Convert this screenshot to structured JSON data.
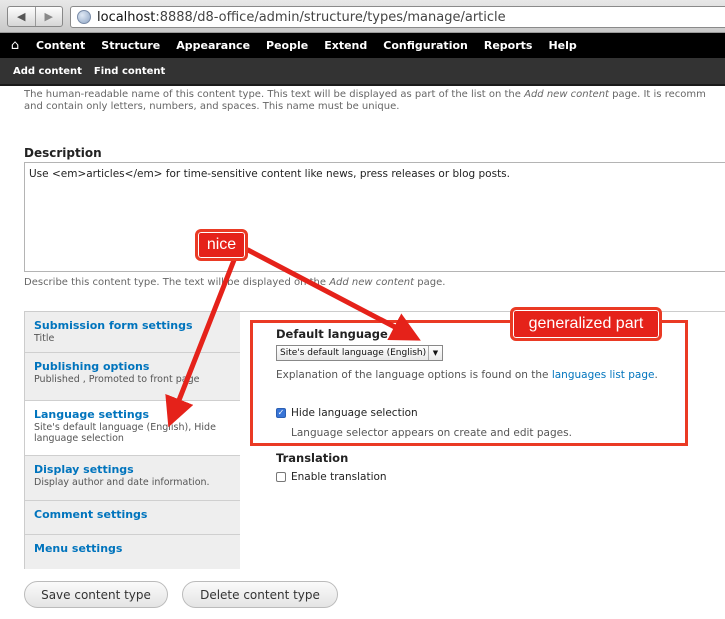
{
  "browser": {
    "url_host": "localhost",
    "url_rest": ":8888/d8-office/admin/structure/types/manage/article"
  },
  "toolbar": {
    "items": [
      "Content",
      "Structure",
      "Appearance",
      "People",
      "Extend",
      "Configuration",
      "Reports",
      "Help"
    ]
  },
  "shortcuts": {
    "items": [
      "Add content",
      "Find content"
    ]
  },
  "name_field": {
    "help_line1_a": "The human-readable name of this content type. This text will be displayed as part of the list on the ",
    "help_line1_em": "Add new content",
    "help_line1_b": " page. It is recomm",
    "help_line2": "and contain only letters, numbers, and spaces. This name must be unique."
  },
  "description": {
    "label": "Description",
    "value": "Use <em>articles</em> for time-sensitive content like news, press releases or blog posts.",
    "help_a": "Describe this content type. The text will be displayed on the ",
    "help_em": "Add new content",
    "help_b": " page."
  },
  "tabs": [
    {
      "title": "Submission form settings",
      "summary": "Title"
    },
    {
      "title": "Publishing options",
      "summary": "Published , Promoted to front page"
    },
    {
      "title": "Language settings",
      "summary": "Site's default language (English), Hide language selection"
    },
    {
      "title": "Display settings",
      "summary": "Display author and date information."
    },
    {
      "title": "Comment settings",
      "summary": ""
    },
    {
      "title": "Menu settings",
      "summary": ""
    }
  ],
  "language": {
    "default_label": "Default language",
    "select_value": "Site's default language (English)",
    "help_a": "Explanation of the language options is found on the ",
    "help_link": "languages list page",
    "help_b": ".",
    "hide_label": "Hide language selection",
    "hide_checked": true,
    "hide_help": "Language selector appears on create and edit pages."
  },
  "translation": {
    "label": "Translation",
    "enable_label": "Enable translation",
    "enable_checked": false
  },
  "buttons": {
    "save": "Save content type",
    "delete": "Delete content type"
  },
  "annotations": {
    "nice": "nice",
    "generalized": "generalized part",
    "color": "#e5221a"
  }
}
